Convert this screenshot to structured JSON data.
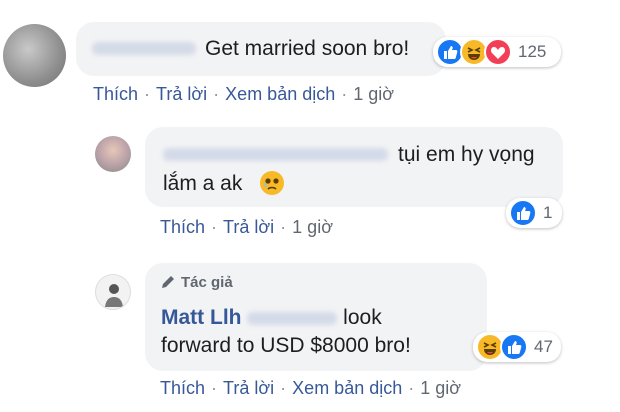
{
  "comment": {
    "text": "Get married soon bro!",
    "actions": {
      "like": "Thích",
      "reply": "Trả lời",
      "translate": "Xem bản dịch",
      "time": "1 giờ"
    },
    "reaction_count": "125"
  },
  "replies": [
    {
      "text_line1": "tụi em hy vọng",
      "text_line2": "lắm a ak",
      "actions": {
        "like": "Thích",
        "reply": "Trả lời",
        "time": "1 giờ"
      },
      "reaction_count": "1"
    },
    {
      "author_badge": "Tác giả",
      "name": "Matt Llh",
      "text_line1": "look",
      "text_line2": "forward to USD $8000 bro!",
      "actions": {
        "like": "Thích",
        "reply": "Trả lời",
        "translate": "Xem bản dịch",
        "time": "1 giờ"
      },
      "reaction_count": "47"
    }
  ],
  "colors": {
    "link": "#385898",
    "name": "#365899",
    "bubble": "#f2f3f5",
    "like": "#1877f2",
    "haha": "#f7b928",
    "love": "#f33e58"
  }
}
